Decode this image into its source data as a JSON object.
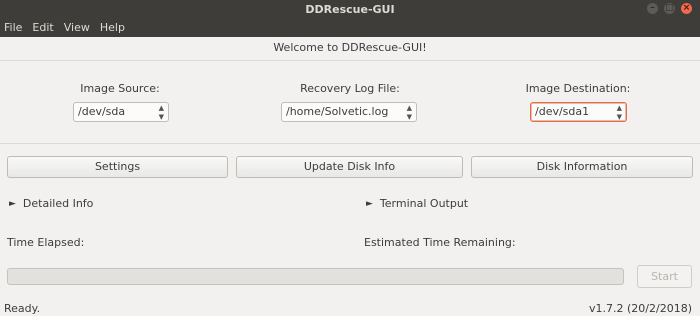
{
  "window": {
    "title": "DDRescue-GUI",
    "controls": {
      "minimize": "–",
      "maximize": "□",
      "close": "×"
    }
  },
  "menu": {
    "items": [
      "File",
      "Edit",
      "View",
      "Help"
    ]
  },
  "welcome": "Welcome to DDRescue-GUI!",
  "fields": {
    "image_source": {
      "label": "Image Source:",
      "value": "/dev/sda"
    },
    "recovery_log": {
      "label": "Recovery Log File:",
      "value": "/home/Solvetic.log"
    },
    "image_destination": {
      "label": "Image Destination:",
      "value": "/dev/sda1"
    }
  },
  "buttons": {
    "settings": "Settings",
    "update_disk_info": "Update Disk Info",
    "disk_information": "Disk Information",
    "start": "Start"
  },
  "expanders": {
    "detailed_info": "Detailed Info",
    "terminal_output": "Terminal Output"
  },
  "time": {
    "elapsed_label": "Time Elapsed:",
    "remaining_label": "Estimated Time Remaining:"
  },
  "progress": {
    "fraction": 0
  },
  "status": {
    "message": "Ready.",
    "version": "v1.7.2 (20/2/2018)"
  },
  "colors": {
    "titlebar": "#3e3d39",
    "focus_border": "#e06e4b",
    "window_bg": "#f2f1f0"
  },
  "icons": {
    "expander": "triangle-right-icon",
    "combo": "spinner-arrows-icon"
  }
}
